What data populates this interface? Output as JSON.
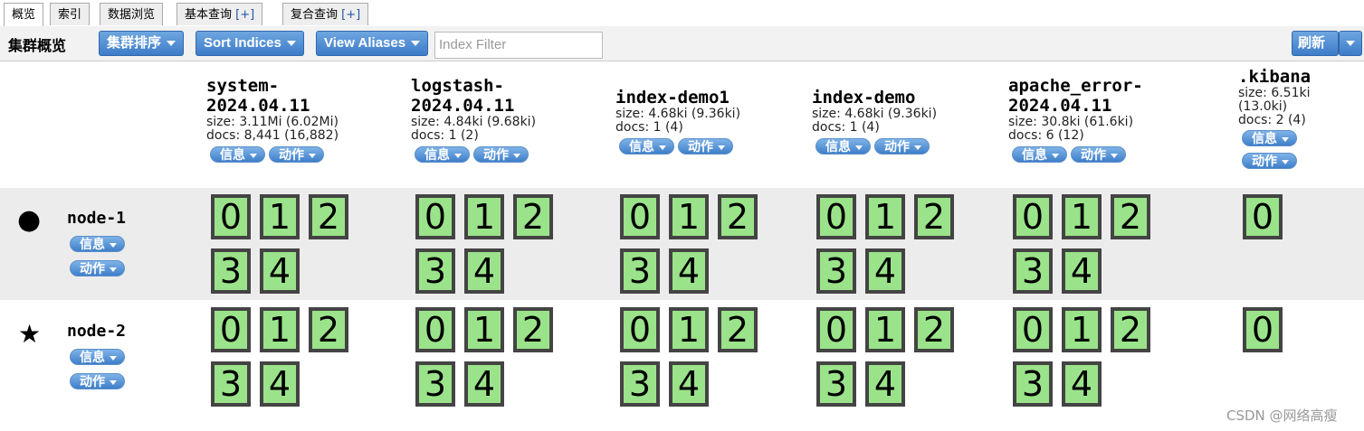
{
  "tabs": [
    {
      "label": "概览",
      "plus": ""
    },
    {
      "label": "索引",
      "plus": ""
    },
    {
      "label": "数据浏览",
      "plus": ""
    },
    {
      "label": "基本查询 ",
      "plus": "[+]"
    },
    {
      "label": "复合查询 ",
      "plus": "[+]"
    }
  ],
  "toolbar": {
    "title": "集群概览",
    "cluster_sort": "集群排序",
    "sort_indices": "Sort Indices",
    "view_aliases": "View Aliases",
    "filter_placeholder": "Index Filter",
    "refresh": "刷新"
  },
  "pill": {
    "info": "信息",
    "action": "动作"
  },
  "indices": [
    {
      "name1": "system-",
      "name2": "2024.04.11",
      "size": "size: 3.11Mi (6.02Mi)",
      "docs": "docs: 8,441 (16,882)",
      "size2": ""
    },
    {
      "name1": "logstash-",
      "name2": "2024.04.11",
      "size": "size: 4.84ki (9.68ki)",
      "docs": "docs: 1 (2)",
      "size2": ""
    },
    {
      "name1": "index-demo1",
      "name2": "",
      "size": "size: 4.68ki (9.36ki)",
      "docs": "docs: 1 (4)",
      "size2": ""
    },
    {
      "name1": "index-demo",
      "name2": "",
      "size": "size: 4.68ki (9.36ki)",
      "docs": "docs: 1 (4)",
      "size2": ""
    },
    {
      "name1": "apache_error-",
      "name2": "2024.04.11",
      "size": "size: 30.8ki (61.6ki)",
      "docs": "docs: 6 (12)",
      "size2": ""
    },
    {
      "name1": ".kibana",
      "name2": "",
      "size": "size: 6.51ki",
      "docs": "docs: 2 (4)",
      "size2": "(13.0ki)"
    }
  ],
  "nodes": [
    {
      "name": "node-1",
      "icon": "circle-icon",
      "glyph": "●"
    },
    {
      "name": "node-2",
      "icon": "star-icon",
      "glyph": "★"
    }
  ],
  "shards": {
    "labels": [
      "0",
      "1",
      "2",
      "3",
      "4"
    ],
    "kibana": [
      "0"
    ]
  },
  "watermark": "CSDN @网络高瘦",
  "colors": {
    "shard_fill": "#9be38a",
    "button_blue": "#3d7cc9",
    "row_shade": "#ececec"
  }
}
